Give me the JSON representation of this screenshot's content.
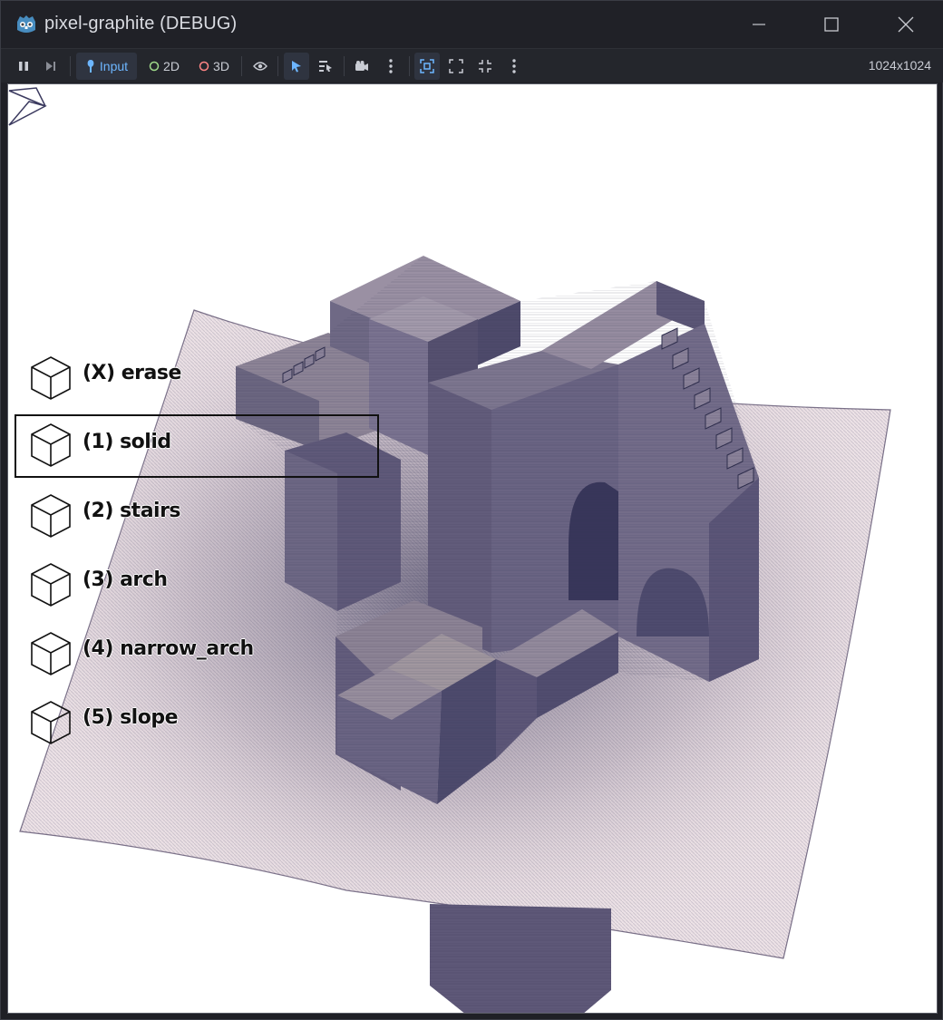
{
  "window": {
    "title": "pixel-graphite (DEBUG)",
    "app_icon": "godot-icon"
  },
  "toolbar": {
    "input_label": "Input",
    "mode_2d_label": "2D",
    "mode_3d_label": "3D",
    "resolution": "1024x1024",
    "accent_color": "#6db6ff"
  },
  "palette": {
    "items": [
      {
        "label": "(X) erase",
        "selected": false
      },
      {
        "label": "(1) solid",
        "selected": true
      },
      {
        "label": "(2) stairs",
        "selected": false
      },
      {
        "label": "(3) arch",
        "selected": false
      },
      {
        "label": "(4) narrow_arch",
        "selected": false
      },
      {
        "label": "(5) slope",
        "selected": false
      }
    ]
  },
  "scene": {
    "ground_color": "#ede2e6",
    "stone_light": "#8d8496",
    "stone_mid": "#6b6680",
    "stone_dark": "#3c3b60"
  }
}
